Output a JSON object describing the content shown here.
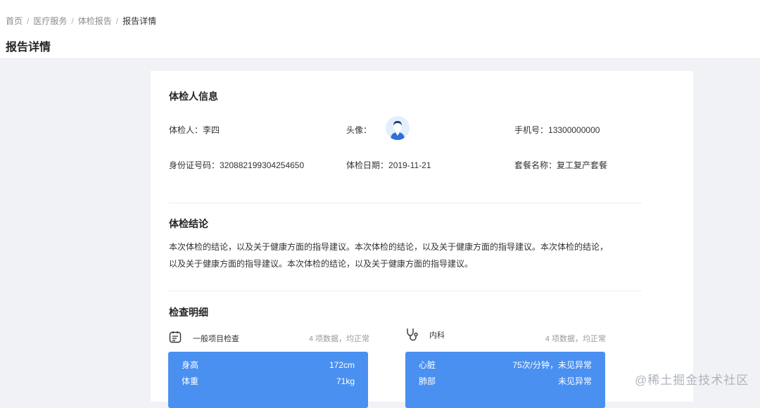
{
  "breadcrumb": [
    "首页",
    "医疗服务",
    "体检报告",
    "报告详情"
  ],
  "page_title": "报告详情",
  "person_section": {
    "title": "体检人信息",
    "name_label": "体检人：",
    "name_value": "李四",
    "avatar_label": "头像：",
    "phone_label": "手机号：",
    "phone_value": "13300000000",
    "id_label": "身份证号码：",
    "id_value": "320882199304254650",
    "date_label": "体检日期：",
    "date_value": "2019-11-21",
    "package_label": "套餐名称：",
    "package_value": "复工复产套餐"
  },
  "conclusion_section": {
    "title": "体检结论",
    "text": "本次体检的结论，以及关于健康方面的指导建议。本次体检的结论，以及关于健康方面的指导建议。本次体检的结论，以及关于健康方面的指导建议。本次体检的结论，以及关于健康方面的指导建议。"
  },
  "detail_section": {
    "title": "检查明细",
    "groups": [
      {
        "name": "一般项目检查",
        "summary": "4 项数据，均正常",
        "icon": "clipboard-icon",
        "items": [
          {
            "label": "身高",
            "value": "172cm"
          },
          {
            "label": "体重",
            "value": "71kg"
          }
        ]
      },
      {
        "name": "内科",
        "summary": "4 项数据，均正常",
        "icon": "stethoscope-icon",
        "items": [
          {
            "label": "心脏",
            "value": "75次/分钟，未见异常"
          },
          {
            "label": "肺部",
            "value": "未见异常"
          }
        ]
      }
    ]
  },
  "watermark": "@稀土掘金技术社区",
  "colors": {
    "accent": "#4a90f0",
    "avatar_bg": "#e3efff",
    "page_bg": "#f0f2f5"
  }
}
